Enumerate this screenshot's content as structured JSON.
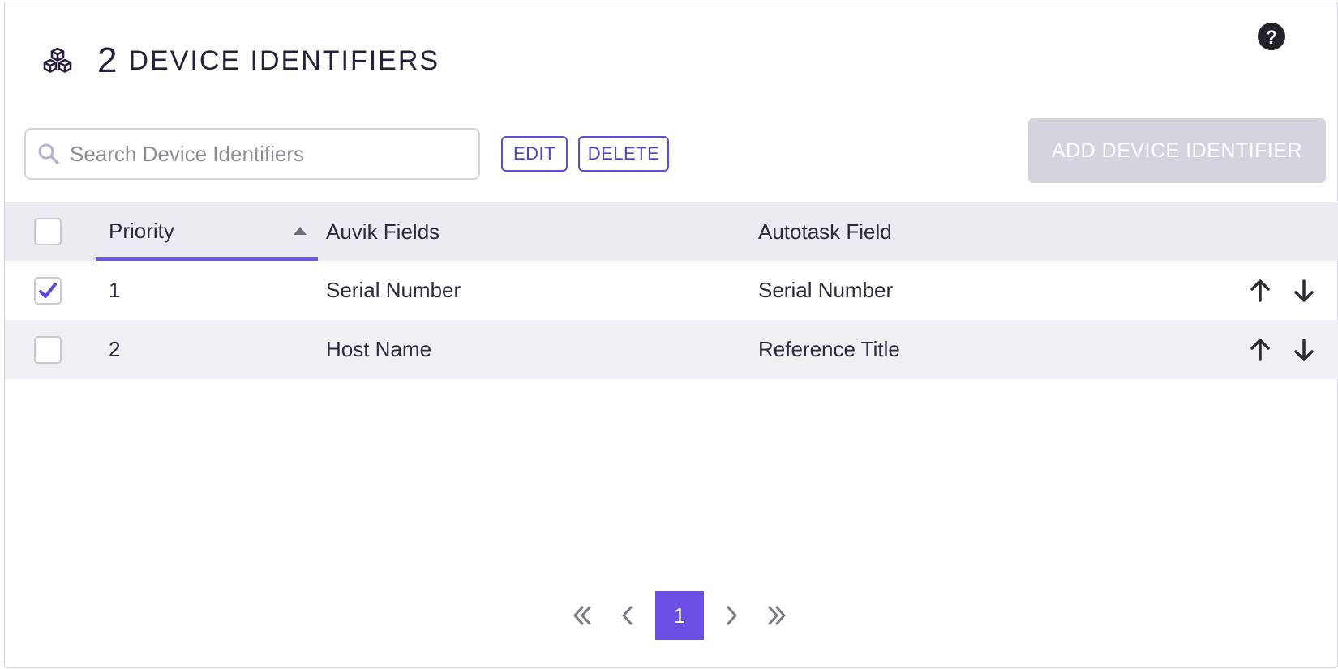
{
  "header": {
    "count": "2",
    "title": "DEVICE IDENTIFIERS",
    "icon": "cubes-icon"
  },
  "help": {
    "icon": "question-icon",
    "glyph": "?"
  },
  "toolbar": {
    "search_placeholder": "Search Device Identifiers",
    "search_value": "",
    "edit_label": "EDIT",
    "delete_label": "DELETE",
    "add_label": "ADD DEVICE IDENTIFIER"
  },
  "table": {
    "columns": {
      "priority": "Priority",
      "auvik": "Auvik Fields",
      "autotask": "Autotask Field"
    },
    "sort": {
      "column": "priority",
      "direction": "ascending"
    },
    "rows": [
      {
        "priority": "1",
        "auvik": "Serial Number",
        "autotask": "Serial Number",
        "checked": true
      },
      {
        "priority": "2",
        "auvik": "Host Name",
        "autotask": "Reference Title",
        "checked": false
      }
    ]
  },
  "pagination": {
    "current_page": "1"
  },
  "colors": {
    "accent": "#6b4fe4",
    "button_outline": "#5a4fcf",
    "add_button_disabled": "#d6d3df",
    "header_row": "#ebebf1"
  }
}
